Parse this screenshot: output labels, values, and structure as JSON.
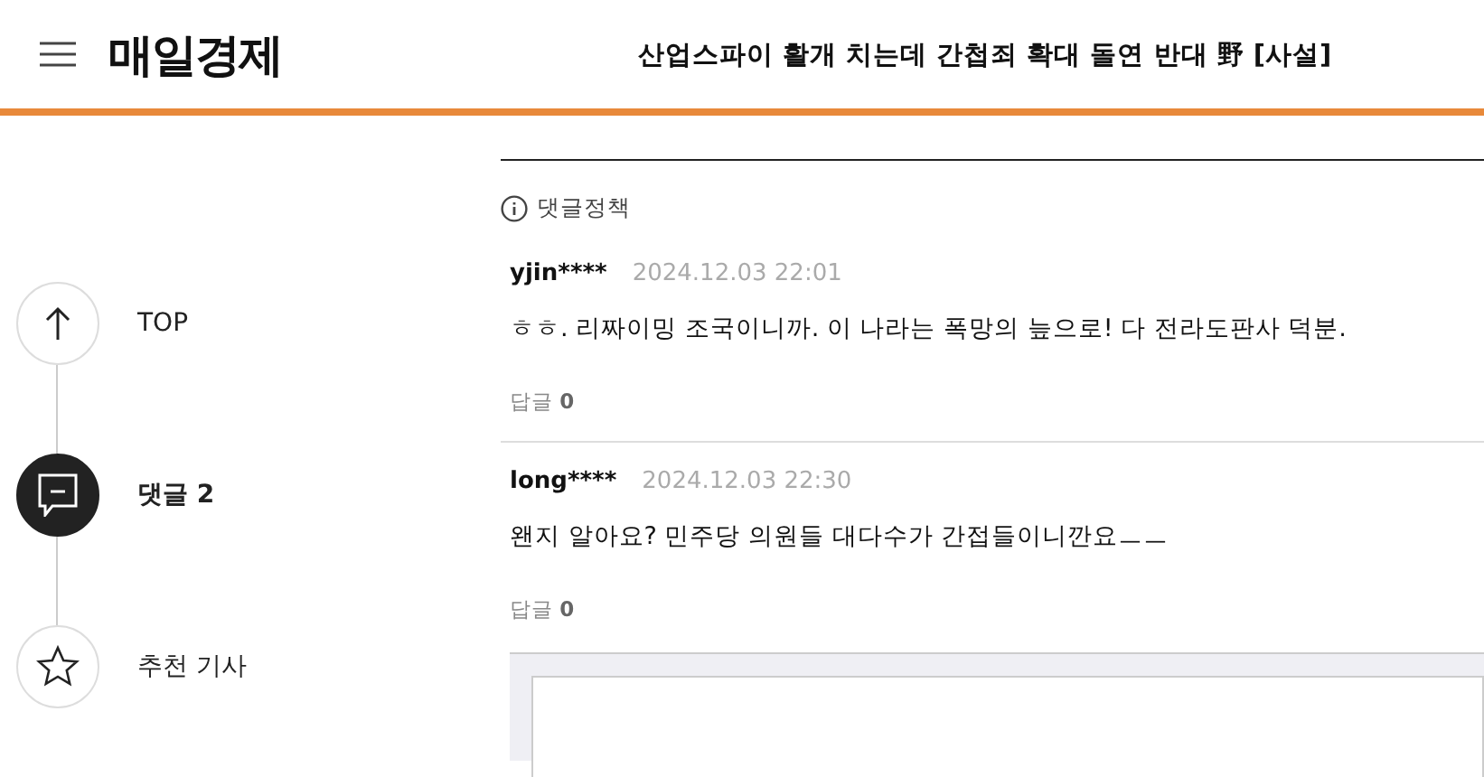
{
  "header": {
    "logo": "매일경제",
    "article_title": "산업스파이 활개 치는데 간첩죄 확대 돌연 반대 野 [사설]"
  },
  "side_nav": [
    {
      "kind": "top",
      "label": "TOP",
      "selected": false
    },
    {
      "kind": "comments",
      "label": "댓글 2",
      "selected": true
    },
    {
      "kind": "recommended",
      "label": "추천 기사",
      "selected": false
    }
  ],
  "comment_policy": "댓글정책",
  "comments": [
    {
      "user": "yjin****",
      "time": "2024.12.03 22:01",
      "text": "ㅎㅎ. 리짜이밍 조국이니까. 이 나라는 폭망의 늪으로! 다 전라도판사 덕분.",
      "reply_label": "답글",
      "reply_count": "0"
    },
    {
      "user": "long****",
      "time": "2024.12.03 22:30",
      "text": "왠지 알아요? 민주당 의원들 대다수가 간접들이니깐요ㅡㅡ",
      "reply_label": "답글",
      "reply_count": "0"
    }
  ]
}
